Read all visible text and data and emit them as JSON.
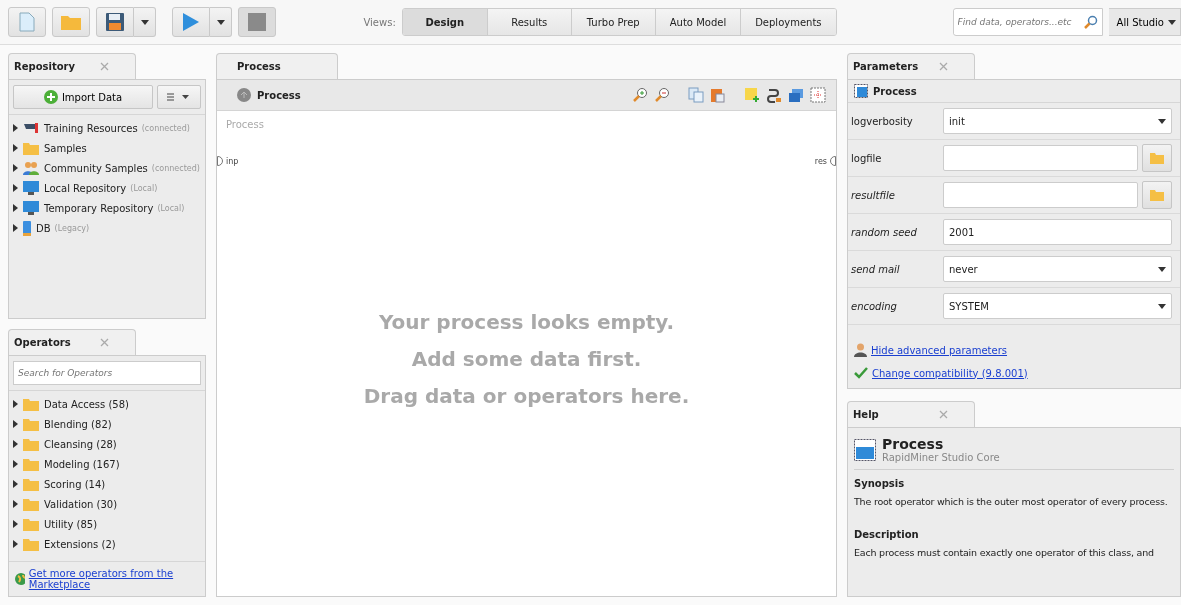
{
  "toolbar": {
    "views_label": "Views:",
    "views": [
      {
        "label": "Design",
        "selected": true
      },
      {
        "label": "Results",
        "selected": false
      },
      {
        "label": "Turbo Prep",
        "selected": false
      },
      {
        "label": "Auto Model",
        "selected": false
      },
      {
        "label": "Deployments",
        "selected": false
      }
    ],
    "search": {
      "placeholder": "Find data, operators...etc"
    },
    "scope": "All Studio"
  },
  "repository": {
    "tab": "Repository",
    "import_button": "Import Data",
    "items": [
      {
        "kind": "training",
        "name": "Training Resources",
        "note": "(connected)"
      },
      {
        "kind": "folder",
        "name": "Samples"
      },
      {
        "kind": "community",
        "name": "Community Samples",
        "note": "(connected)"
      },
      {
        "kind": "local",
        "name": "Local Repository",
        "note": "(Local)"
      },
      {
        "kind": "local",
        "name": "Temporary Repository",
        "note": "(Local)"
      },
      {
        "kind": "db",
        "name": "DB",
        "note": "(Legacy)"
      }
    ]
  },
  "operators": {
    "tab": "Operators",
    "search": {
      "placeholder": "Search for Operators"
    },
    "items": [
      "Data Access (58)",
      "Blending (82)",
      "Cleansing (28)",
      "Modeling (167)",
      "Scoring (14)",
      "Validation (30)",
      "Utility (85)",
      "Extensions (2)"
    ],
    "marketplace_link": "Get more operators from the Marketplace"
  },
  "process": {
    "tab": "Process",
    "breadcrumb": "Process",
    "canvas_title": "Process",
    "input_port": "inp",
    "output_port": "res",
    "empty_message": [
      "Your process looks empty.",
      "Add some data first.",
      "Drag data or operators here."
    ]
  },
  "parameters": {
    "tab": "Parameters",
    "operator": "Process",
    "rows": [
      {
        "label": "logverbosity",
        "kind": "select",
        "value": "init",
        "advanced": false
      },
      {
        "label": "logfile",
        "kind": "file",
        "advanced": false
      },
      {
        "label": "resultfile",
        "kind": "file",
        "advanced": true
      },
      {
        "label": "random seed",
        "kind": "text",
        "value": "2001",
        "advanced": true
      },
      {
        "label": "send mail",
        "kind": "select",
        "value": "never",
        "advanced": true
      },
      {
        "label": "encoding",
        "kind": "select",
        "value": "SYSTEM",
        "advanced": true
      }
    ],
    "hide_link": "Hide advanced parameters",
    "compat_link": "Change compatibility (9.8.001)"
  },
  "help": {
    "tab": "Help",
    "title": "Process",
    "subtitle": "RapidMiner Studio Core",
    "sections": [
      {
        "heading": "Synopsis",
        "text": "The root operator which is the outer most operator of every process."
      },
      {
        "heading": "Description",
        "text": "Each process must contain exactly one operator of this class, and"
      }
    ]
  }
}
